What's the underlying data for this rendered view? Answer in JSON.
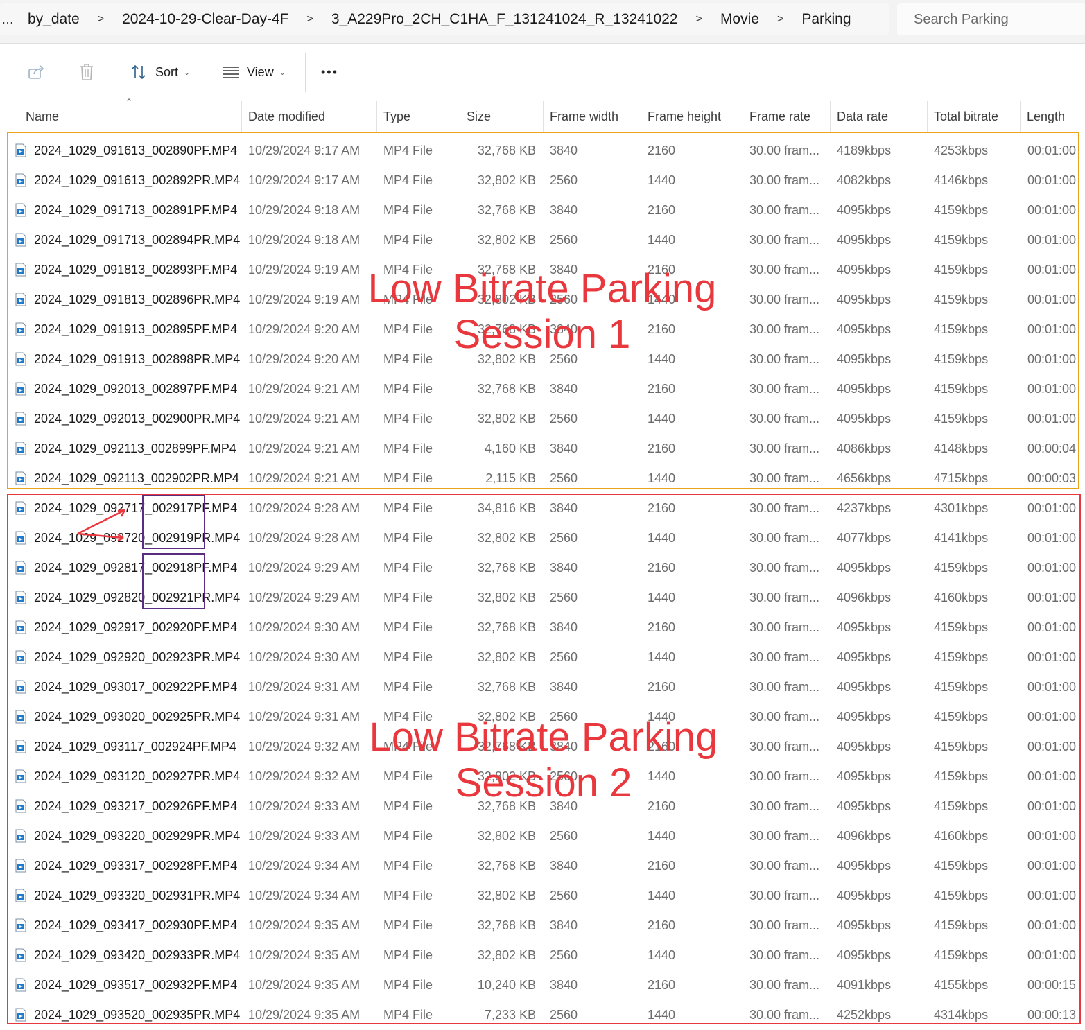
{
  "breadcrumb": {
    "overflow": "…",
    "items": [
      "by_date",
      "2024-10-29-Clear-Day-4F",
      "3_A229Pro_2CH_C1HA_F_131241024_R_13241022",
      "Movie",
      "Parking"
    ],
    "separator": ">"
  },
  "search": {
    "placeholder": "Search Parking"
  },
  "toolbar": {
    "share_icon": "share-icon",
    "delete_icon": "trash-icon",
    "sort_label": "Sort",
    "view_label": "View",
    "more_label": "•••"
  },
  "columns": [
    "Name",
    "Date modified",
    "Type",
    "Size",
    "Frame width",
    "Frame height",
    "Frame rate",
    "Data rate",
    "Total bitrate",
    "Length"
  ],
  "files": [
    {
      "name": "2024_1029_091613_002890PF.MP4",
      "date": "10/29/2024 9:17 AM",
      "type": "MP4 File",
      "size": "32,768 KB",
      "width": "3840",
      "height": "2160",
      "rate": "30.00 fram...",
      "data_rate": "4189kbps",
      "total_bitrate": "4253kbps",
      "length": "00:01:00"
    },
    {
      "name": "2024_1029_091613_002892PR.MP4",
      "date": "10/29/2024 9:17 AM",
      "type": "MP4 File",
      "size": "32,802 KB",
      "width": "2560",
      "height": "1440",
      "rate": "30.00 fram...",
      "data_rate": "4082kbps",
      "total_bitrate": "4146kbps",
      "length": "00:01:00"
    },
    {
      "name": "2024_1029_091713_002891PF.MP4",
      "date": "10/29/2024 9:18 AM",
      "type": "MP4 File",
      "size": "32,768 KB",
      "width": "3840",
      "height": "2160",
      "rate": "30.00 fram...",
      "data_rate": "4095kbps",
      "total_bitrate": "4159kbps",
      "length": "00:01:00"
    },
    {
      "name": "2024_1029_091713_002894PR.MP4",
      "date": "10/29/2024 9:18 AM",
      "type": "MP4 File",
      "size": "32,802 KB",
      "width": "2560",
      "height": "1440",
      "rate": "30.00 fram...",
      "data_rate": "4095kbps",
      "total_bitrate": "4159kbps",
      "length": "00:01:00"
    },
    {
      "name": "2024_1029_091813_002893PF.MP4",
      "date": "10/29/2024 9:19 AM",
      "type": "MP4 File",
      "size": "32,768 KB",
      "width": "3840",
      "height": "2160",
      "rate": "30.00 fram...",
      "data_rate": "4095kbps",
      "total_bitrate": "4159kbps",
      "length": "00:01:00"
    },
    {
      "name": "2024_1029_091813_002896PR.MP4",
      "date": "10/29/2024 9:19 AM",
      "type": "MP4 File",
      "size": "32,802 KB",
      "width": "2560",
      "height": "1440",
      "rate": "30.00 fram...",
      "data_rate": "4095kbps",
      "total_bitrate": "4159kbps",
      "length": "00:01:00"
    },
    {
      "name": "2024_1029_091913_002895PF.MP4",
      "date": "10/29/2024 9:20 AM",
      "type": "MP4 File",
      "size": "32,768 KB",
      "width": "3840",
      "height": "2160",
      "rate": "30.00 fram...",
      "data_rate": "4095kbps",
      "total_bitrate": "4159kbps",
      "length": "00:01:00"
    },
    {
      "name": "2024_1029_091913_002898PR.MP4",
      "date": "10/29/2024 9:20 AM",
      "type": "MP4 File",
      "size": "32,802 KB",
      "width": "2560",
      "height": "1440",
      "rate": "30.00 fram...",
      "data_rate": "4095kbps",
      "total_bitrate": "4159kbps",
      "length": "00:01:00"
    },
    {
      "name": "2024_1029_092013_002897PF.MP4",
      "date": "10/29/2024 9:21 AM",
      "type": "MP4 File",
      "size": "32,768 KB",
      "width": "3840",
      "height": "2160",
      "rate": "30.00 fram...",
      "data_rate": "4095kbps",
      "total_bitrate": "4159kbps",
      "length": "00:01:00"
    },
    {
      "name": "2024_1029_092013_002900PR.MP4",
      "date": "10/29/2024 9:21 AM",
      "type": "MP4 File",
      "size": "32,802 KB",
      "width": "2560",
      "height": "1440",
      "rate": "30.00 fram...",
      "data_rate": "4095kbps",
      "total_bitrate": "4159kbps",
      "length": "00:01:00"
    },
    {
      "name": "2024_1029_092113_002899PF.MP4",
      "date": "10/29/2024 9:21 AM",
      "type": "MP4 File",
      "size": "4,160 KB",
      "width": "3840",
      "height": "2160",
      "rate": "30.00 fram...",
      "data_rate": "4086kbps",
      "total_bitrate": "4148kbps",
      "length": "00:00:04"
    },
    {
      "name": "2024_1029_092113_002902PR.MP4",
      "date": "10/29/2024 9:21 AM",
      "type": "MP4 File",
      "size": "2,115 KB",
      "width": "2560",
      "height": "1440",
      "rate": "30.00 fram...",
      "data_rate": "4656kbps",
      "total_bitrate": "4715kbps",
      "length": "00:00:03"
    },
    {
      "name": "2024_1029_092717_002917PF.MP4",
      "date": "10/29/2024 9:28 AM",
      "type": "MP4 File",
      "size": "34,816 KB",
      "width": "3840",
      "height": "2160",
      "rate": "30.00 fram...",
      "data_rate": "4237kbps",
      "total_bitrate": "4301kbps",
      "length": "00:01:00"
    },
    {
      "name": "2024_1029_092720_002919PR.MP4",
      "date": "10/29/2024 9:28 AM",
      "type": "MP4 File",
      "size": "32,802 KB",
      "width": "2560",
      "height": "1440",
      "rate": "30.00 fram...",
      "data_rate": "4077kbps",
      "total_bitrate": "4141kbps",
      "length": "00:01:00"
    },
    {
      "name": "2024_1029_092817_002918PF.MP4",
      "date": "10/29/2024 9:29 AM",
      "type": "MP4 File",
      "size": "32,768 KB",
      "width": "3840",
      "height": "2160",
      "rate": "30.00 fram...",
      "data_rate": "4095kbps",
      "total_bitrate": "4159kbps",
      "length": "00:01:00"
    },
    {
      "name": "2024_1029_092820_002921PR.MP4",
      "date": "10/29/2024 9:29 AM",
      "type": "MP4 File",
      "size": "32,802 KB",
      "width": "2560",
      "height": "1440",
      "rate": "30.00 fram...",
      "data_rate": "4096kbps",
      "total_bitrate": "4160kbps",
      "length": "00:01:00"
    },
    {
      "name": "2024_1029_092917_002920PF.MP4",
      "date": "10/29/2024 9:30 AM",
      "type": "MP4 File",
      "size": "32,768 KB",
      "width": "3840",
      "height": "2160",
      "rate": "30.00 fram...",
      "data_rate": "4095kbps",
      "total_bitrate": "4159kbps",
      "length": "00:01:00"
    },
    {
      "name": "2024_1029_092920_002923PR.MP4",
      "date": "10/29/2024 9:30 AM",
      "type": "MP4 File",
      "size": "32,802 KB",
      "width": "2560",
      "height": "1440",
      "rate": "30.00 fram...",
      "data_rate": "4095kbps",
      "total_bitrate": "4159kbps",
      "length": "00:01:00"
    },
    {
      "name": "2024_1029_093017_002922PF.MP4",
      "date": "10/29/2024 9:31 AM",
      "type": "MP4 File",
      "size": "32,768 KB",
      "width": "3840",
      "height": "2160",
      "rate": "30.00 fram...",
      "data_rate": "4095kbps",
      "total_bitrate": "4159kbps",
      "length": "00:01:00"
    },
    {
      "name": "2024_1029_093020_002925PR.MP4",
      "date": "10/29/2024 9:31 AM",
      "type": "MP4 File",
      "size": "32,802 KB",
      "width": "2560",
      "height": "1440",
      "rate": "30.00 fram...",
      "data_rate": "4095kbps",
      "total_bitrate": "4159kbps",
      "length": "00:01:00"
    },
    {
      "name": "2024_1029_093117_002924PF.MP4",
      "date": "10/29/2024 9:32 AM",
      "type": "MP4 File",
      "size": "32,768 KB",
      "width": "3840",
      "height": "2160",
      "rate": "30.00 fram...",
      "data_rate": "4095kbps",
      "total_bitrate": "4159kbps",
      "length": "00:01:00"
    },
    {
      "name": "2024_1029_093120_002927PR.MP4",
      "date": "10/29/2024 9:32 AM",
      "type": "MP4 File",
      "size": "32,802 KB",
      "width": "2560",
      "height": "1440",
      "rate": "30.00 fram...",
      "data_rate": "4095kbps",
      "total_bitrate": "4159kbps",
      "length": "00:01:00"
    },
    {
      "name": "2024_1029_093217_002926PF.MP4",
      "date": "10/29/2024 9:33 AM",
      "type": "MP4 File",
      "size": "32,768 KB",
      "width": "3840",
      "height": "2160",
      "rate": "30.00 fram...",
      "data_rate": "4095kbps",
      "total_bitrate": "4159kbps",
      "length": "00:01:00"
    },
    {
      "name": "2024_1029_093220_002929PR.MP4",
      "date": "10/29/2024 9:33 AM",
      "type": "MP4 File",
      "size": "32,802 KB",
      "width": "2560",
      "height": "1440",
      "rate": "30.00 fram...",
      "data_rate": "4096kbps",
      "total_bitrate": "4160kbps",
      "length": "00:01:00"
    },
    {
      "name": "2024_1029_093317_002928PF.MP4",
      "date": "10/29/2024 9:34 AM",
      "type": "MP4 File",
      "size": "32,768 KB",
      "width": "3840",
      "height": "2160",
      "rate": "30.00 fram...",
      "data_rate": "4095kbps",
      "total_bitrate": "4159kbps",
      "length": "00:01:00"
    },
    {
      "name": "2024_1029_093320_002931PR.MP4",
      "date": "10/29/2024 9:34 AM",
      "type": "MP4 File",
      "size": "32,802 KB",
      "width": "2560",
      "height": "1440",
      "rate": "30.00 fram...",
      "data_rate": "4095kbps",
      "total_bitrate": "4159kbps",
      "length": "00:01:00"
    },
    {
      "name": "2024_1029_093417_002930PF.MP4",
      "date": "10/29/2024 9:35 AM",
      "type": "MP4 File",
      "size": "32,768 KB",
      "width": "3840",
      "height": "2160",
      "rate": "30.00 fram...",
      "data_rate": "4095kbps",
      "total_bitrate": "4159kbps",
      "length": "00:01:00"
    },
    {
      "name": "2024_1029_093420_002933PR.MP4",
      "date": "10/29/2024 9:35 AM",
      "type": "MP4 File",
      "size": "32,802 KB",
      "width": "2560",
      "height": "1440",
      "rate": "30.00 fram...",
      "data_rate": "4095kbps",
      "total_bitrate": "4159kbps",
      "length": "00:01:00"
    },
    {
      "name": "2024_1029_093517_002932PF.MP4",
      "date": "10/29/2024 9:35 AM",
      "type": "MP4 File",
      "size": "10,240 KB",
      "width": "3840",
      "height": "2160",
      "rate": "30.00 fram...",
      "data_rate": "4091kbps",
      "total_bitrate": "4155kbps",
      "length": "00:00:15"
    },
    {
      "name": "2024_1029_093520_002935PR.MP4",
      "date": "10/29/2024 9:35 AM",
      "type": "MP4 File",
      "size": "7,233 KB",
      "width": "2560",
      "height": "1440",
      "rate": "30.00 fram...",
      "data_rate": "4252kbps",
      "total_bitrate": "4314kbps",
      "length": "00:00:13"
    }
  ],
  "annotations": {
    "session1": {
      "line1": "Low Bitrate Parking",
      "line2": "Session 1",
      "color": "#e8a317"
    },
    "session2": {
      "line1": "Low Bitrate Parking",
      "line2": "Session 2",
      "color": "#e8383d"
    },
    "highlight_color": "#5b2c83",
    "text_color": "#e8383d"
  },
  "colors": {
    "file_icon": "#1f7acb",
    "header_text": "#3c3c3c",
    "cell_text": "#6b6b6b"
  }
}
